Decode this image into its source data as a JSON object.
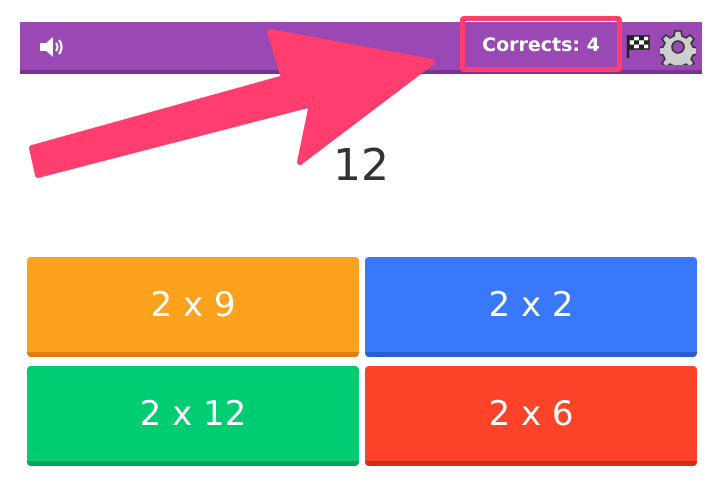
{
  "header": {
    "score_label": "Corrects: 4",
    "icons": [
      "speaker-icon",
      "checkered-flag-icon",
      "gear-icon"
    ]
  },
  "question": {
    "target": "12"
  },
  "answers": [
    {
      "label": "2 x 9",
      "color": "#fca21f"
    },
    {
      "label": "2 x 2",
      "color": "#3a78fb"
    },
    {
      "label": "2 x 12",
      "color": "#00cc72"
    },
    {
      "label": "2 x 6",
      "color": "#fd4329"
    }
  ],
  "colors": {
    "header_bg": "#9a48b3",
    "highlight": "#ff3d6e"
  }
}
